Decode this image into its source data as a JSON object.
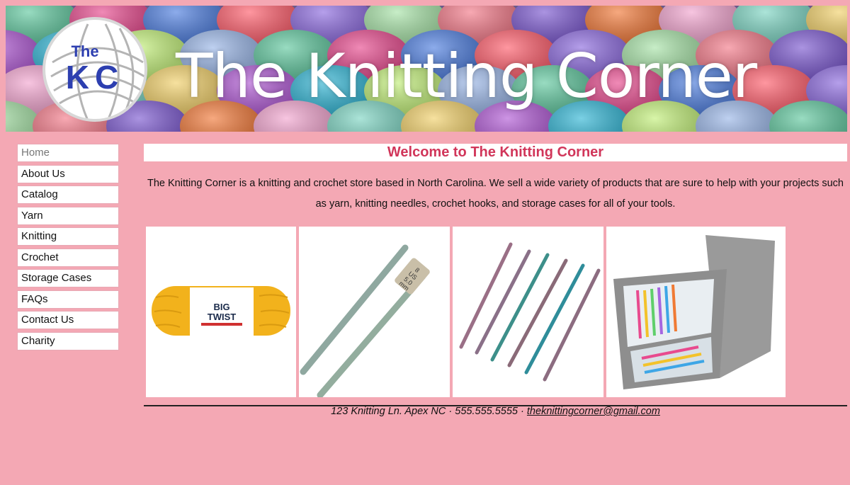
{
  "banner": {
    "title": "The Knitting Corner",
    "logo_line1": "The",
    "logo_line2": "KC"
  },
  "nav": {
    "items": [
      {
        "label": "Home",
        "active": true
      },
      {
        "label": "About Us"
      },
      {
        "label": "Catalog"
      },
      {
        "label": "Yarn"
      },
      {
        "label": "Knitting"
      },
      {
        "label": "Crochet"
      },
      {
        "label": "Storage Cases"
      },
      {
        "label": "FAQs"
      },
      {
        "label": "Contact Us"
      },
      {
        "label": "Charity"
      }
    ]
  },
  "main": {
    "heading": "Welcome to The Knitting Corner",
    "intro": "The Knitting Corner is a knitting and crochet store based in North Carolina. We sell a wide variety of products that are sure to help with your projects such as yarn, knitting needles, crochet hooks, and storage cases for all of your tools.",
    "products": {
      "yarn_label_line1": "BIG",
      "yarn_label_line2": "TWIST",
      "needle_tag_line1": "8",
      "needle_tag_line2": "US",
      "needle_tag_line3": "5.0",
      "needle_tag_line4": "mm"
    }
  },
  "footer": {
    "address": "123 Knitting Ln. Apex NC",
    "separator": "·",
    "phone": "555.555.5555",
    "email": "theknittingcorner@gmail.com"
  },
  "colors": {
    "page_bg": "#f4a8b4",
    "heading": "#d1365a",
    "logo_text": "#2d3fb0"
  }
}
